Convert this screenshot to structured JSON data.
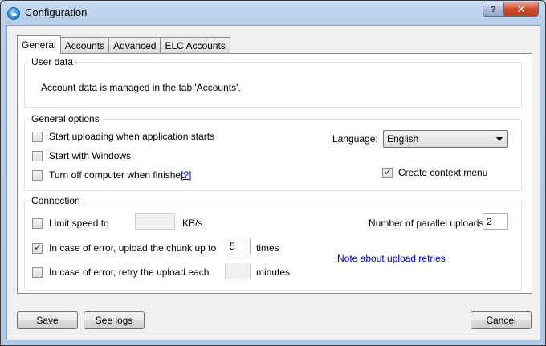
{
  "window": {
    "title": "Configuration",
    "help_label": "?",
    "close_label": "✕"
  },
  "tabs": [
    {
      "label": "General",
      "active": true
    },
    {
      "label": "Accounts"
    },
    {
      "label": "Advanced"
    },
    {
      "label": "ELC Accounts"
    }
  ],
  "user_data": {
    "title": "User data",
    "message": "Account data is managed in the tab 'Accounts'."
  },
  "general_options": {
    "title": "General options",
    "start_uploading": {
      "label": "Start uploading when application starts",
      "checked": false
    },
    "start_with_windows": {
      "label": "Start with Windows",
      "checked": false
    },
    "turn_off": {
      "label": "Turn off computer when finished",
      "checked": false
    },
    "help_link": "[?]",
    "language_label": "Language:",
    "language_value": "English",
    "context_menu": {
      "label": "Create context menu",
      "checked": true
    }
  },
  "connection": {
    "title": "Connection",
    "limit_speed": {
      "label": "Limit speed to",
      "checked": false,
      "value": "",
      "unit": "KB/s"
    },
    "parallel_label": "Number of parallel uploads:",
    "parallel_value": "2",
    "error_chunk": {
      "label": "In case of error, upload the chunk up to",
      "checked": true,
      "value": "5",
      "unit": "times"
    },
    "retry_link": "Note about upload retries",
    "error_retry": {
      "label": "In case of error, retry the upload each",
      "checked": false,
      "value": "",
      "unit": "minutes"
    }
  },
  "footer": {
    "save": "Save",
    "see_logs": "See logs",
    "cancel": "Cancel"
  }
}
